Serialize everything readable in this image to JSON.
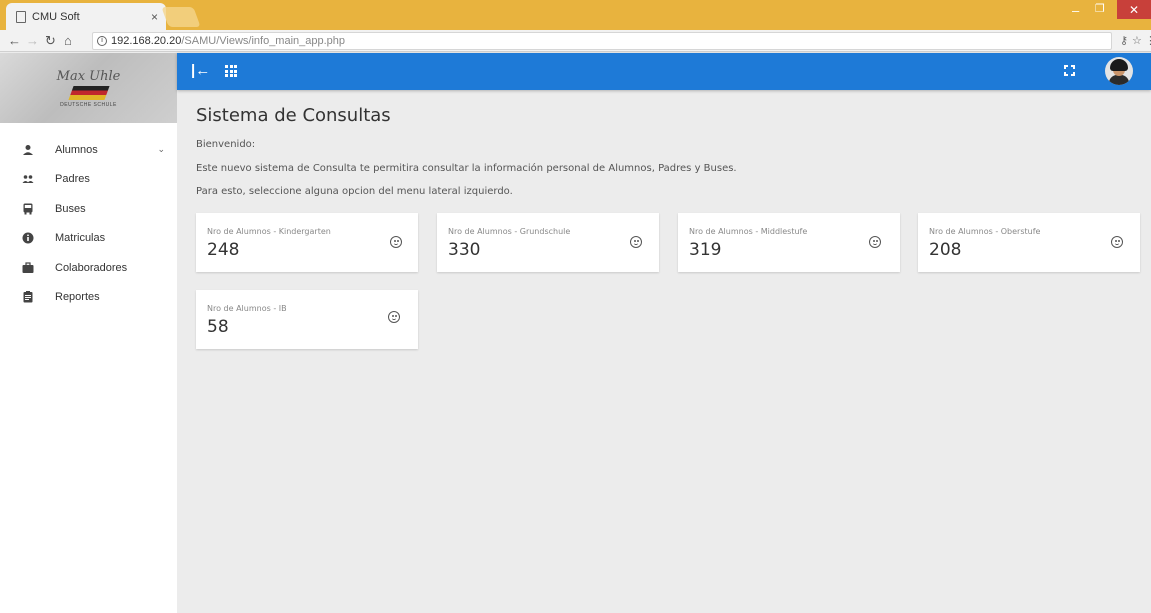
{
  "browser": {
    "tab_title": "CMU Soft",
    "tab_close": "×",
    "url_host": "192.168.20.20",
    "url_path": "/SAMU/Views/info_main_app.php"
  },
  "sidebar": {
    "logo_text": "Max Uhle",
    "logo_subtext": "DEUTSCHE SCHULE",
    "items": [
      {
        "label": "Alumnos",
        "icon": "person-icon",
        "has_chevron": true
      },
      {
        "label": "Padres",
        "icon": "people-icon"
      },
      {
        "label": "Buses",
        "icon": "bus-icon"
      },
      {
        "label": "Matriculas",
        "icon": "info-icon"
      },
      {
        "label": "Colaboradores",
        "icon": "briefcase-icon"
      },
      {
        "label": "Reportes",
        "icon": "clipboard-icon"
      }
    ]
  },
  "main": {
    "title": "Sistema de Consultas",
    "welcome": "Bienvenido:",
    "description": "Este nuevo sistema de Consulta te permitira consultar la información personal de Alumnos, Padres y Buses.",
    "instruction": "Para esto, seleccione alguna opcion del menu lateral izquierdo."
  },
  "cards": [
    {
      "label": "Nro de Alumnos - Kindergarten",
      "value": "248",
      "icon": "face-icon"
    },
    {
      "label": "Nro de Alumnos - Grundschule",
      "value": "330",
      "icon": "face-icon"
    },
    {
      "label": "Nro de Alumnos - Middlestufe",
      "value": "319",
      "icon": "smile-icon"
    },
    {
      "label": "Nro de Alumnos - Oberstufe",
      "value": "208",
      "icon": "smile-icon"
    },
    {
      "label": "Nro de Alumnos - IB",
      "value": "58",
      "icon": "child-icon"
    }
  ],
  "colors": {
    "topbar": "#1e7ad7",
    "tabbar": "#e8b33e",
    "background": "#ececec"
  }
}
